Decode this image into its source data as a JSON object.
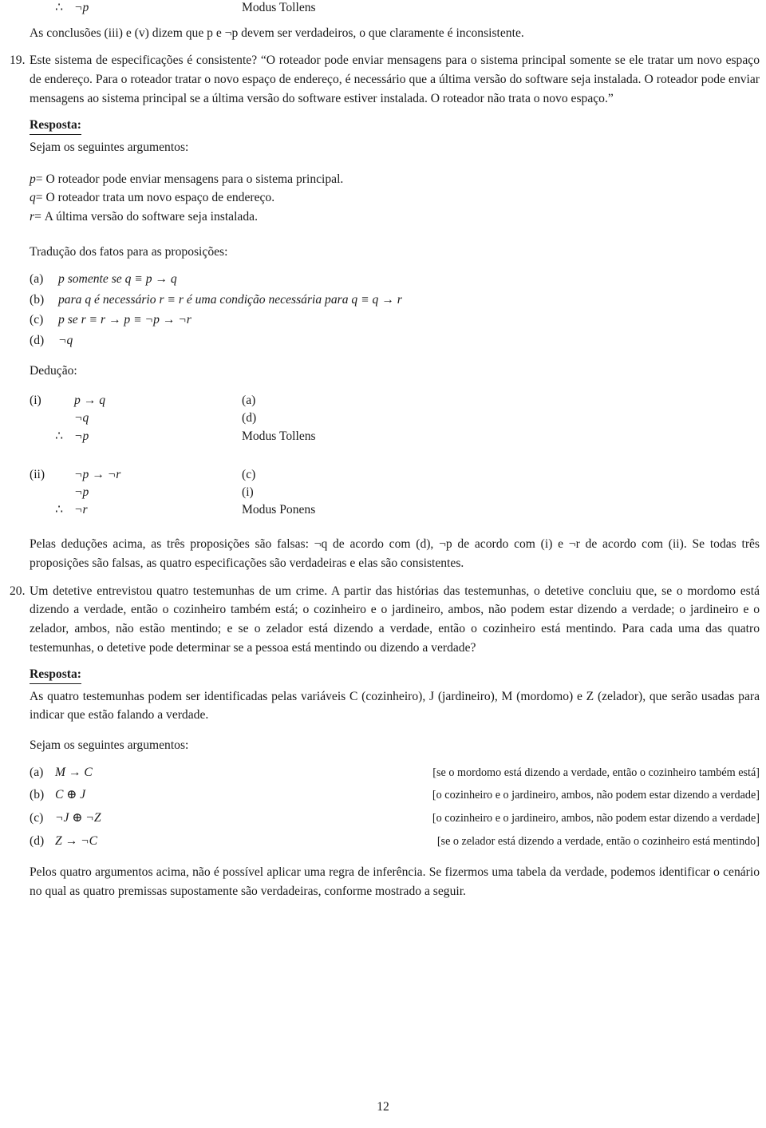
{
  "document": {
    "page_number": "12",
    "language": "pt-BR"
  },
  "top_fragment": {
    "therefore_symbol": "∴",
    "formula": "¬p",
    "justification": "Modus Tollens"
  },
  "intro_paragraph": "As conclusões (iii) e (v) dizem que p e ¬p devem ser verdadeiros, o que claramente é inconsistente.",
  "exercise_19": {
    "number": "19.",
    "statement": "Este sistema de especificações é consistente? “O roteador pode enviar mensagens para o sistema principal somente se ele tratar um novo espaço de endereço. Para o roteador tratar o novo espaço de endereço, é necessário que a última versão do software seja instalada. O roteador pode enviar mensagens ao sistema principal se a última versão do software estiver instalada. O roteador não trata o novo espaço.”",
    "answer_label": "Resposta:",
    "arguments_intro": "Sejam os seguintes argumentos:",
    "definitions": [
      {
        "variable": "p",
        "equals": "=",
        "text": "O roteador pode enviar mensagens para o sistema principal."
      },
      {
        "variable": "q",
        "equals": "=",
        "text": "O roteador trata um novo espaço de endereço."
      },
      {
        "variable": "r",
        "equals": "=",
        "text": "A última versão do software seja instalada."
      }
    ],
    "translation_intro": "Tradução dos fatos para as proposições:",
    "propositions": [
      {
        "tag": "(a)",
        "formula": "p somente se q ≡ p → q"
      },
      {
        "tag": "(b)",
        "formula": "para q é necessário r ≡ r é uma condição necessária para q ≡ q → r"
      },
      {
        "tag": "(c)",
        "formula": "p se r ≡ r → p ≡ ¬p → ¬r"
      },
      {
        "tag": "(d)",
        "formula": "¬q"
      }
    ],
    "deduction_label": "Dedução:",
    "deductions": [
      {
        "tag": "(i)",
        "rows": [
          {
            "prefix": "",
            "formula": "p → q",
            "justification": "(a)"
          },
          {
            "prefix": "",
            "formula": "¬q",
            "justification": "(d)"
          },
          {
            "prefix": "∴",
            "formula": "¬p",
            "justification": "Modus Tollens"
          }
        ]
      },
      {
        "tag": "(ii)",
        "rows": [
          {
            "prefix": "",
            "formula": "¬p → ¬r",
            "justification": "(c)"
          },
          {
            "prefix": "",
            "formula": "¬p",
            "justification": "(i)"
          },
          {
            "prefix": "∴",
            "formula": "¬r",
            "justification": "Modus Ponens"
          }
        ]
      }
    ],
    "conclusion": "Pelas deduções acima, as três proposições são falsas: ¬q de acordo com (d), ¬p de acordo com (i) e ¬r de acordo com (ii). Se todas três proposições são falsas, as quatro especificações são verdadeiras e elas são consistentes."
  },
  "exercise_20": {
    "number": "20.",
    "statement": "Um detetive entrevistou quatro testemunhas de um crime. A partir das histórias das testemunhas, o detetive concluiu que, se o mordomo está dizendo a verdade, então o cozinheiro também está; o cozinheiro e o jardineiro, ambos, não podem estar dizendo a verdade; o jardineiro e o zelador, ambos, não estão mentindo; e se o zelador está dizendo a verdade, então o cozinheiro está mentindo. Para cada uma das quatro testemunhas, o detetive pode determinar se a pessoa está mentindo ou dizendo a verdade?",
    "answer_label": "Resposta:",
    "answer_paragraph": "As quatro testemunhas podem ser identificadas pelas variáveis C (cozinheiro), J (jardineiro), M (mordomo) e Z (zelador), que serão usadas para indicar que estão falando a verdade.",
    "arguments_intro": "Sejam os seguintes argumentos:",
    "arguments": [
      {
        "tag": "(a)",
        "formula": "M → C",
        "description": "[se o mordomo está dizendo a verdade, então o cozinheiro também está]"
      },
      {
        "tag": "(b)",
        "formula": "C ⊕ J",
        "description": "[o cozinheiro e o jardineiro, ambos, não podem estar dizendo a verdade]"
      },
      {
        "tag": "(c)",
        "formula": "¬J ⊕ ¬Z",
        "description": "[o cozinheiro e o jardineiro, ambos, não podem estar dizendo a verdade]"
      },
      {
        "tag": "(d)",
        "formula": "Z → ¬C",
        "description": "[se o zelador está dizendo a verdade, então o cozinheiro está mentindo]"
      }
    ],
    "closing": "Pelos quatro argumentos acima, não é possível aplicar uma regra de inferência. Se fizermos uma tabela da verdade, podemos identificar o cenário no qual as quatro premissas supostamente são verdadeiras, conforme mostrado a seguir."
  }
}
